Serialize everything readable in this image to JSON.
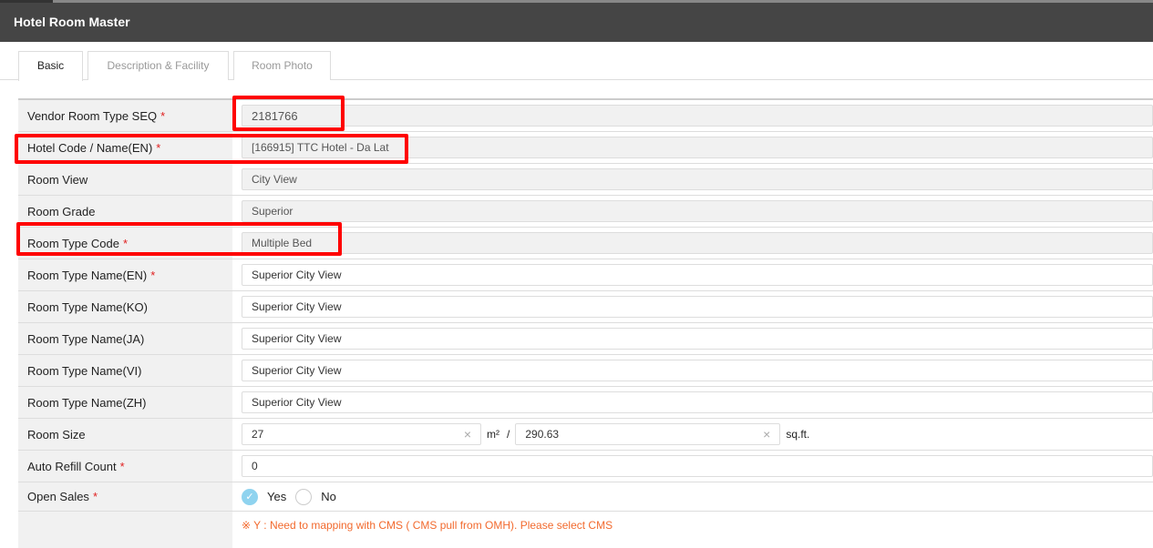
{
  "header": {
    "title": "Hotel Room Master"
  },
  "tabs": [
    {
      "label": "Basic"
    },
    {
      "label": "Description & Facility"
    },
    {
      "label": "Room Photo"
    }
  ],
  "form": {
    "vendor_seq": {
      "label": "Vendor Room Type SEQ",
      "value": "2181766"
    },
    "hotel": {
      "label": "Hotel Code / Name(EN)",
      "value": "[166915] TTC Hotel - Da Lat"
    },
    "room_view": {
      "label": "Room View",
      "value": "City View"
    },
    "room_grade": {
      "label": "Room Grade",
      "value": "Superior"
    },
    "room_type_code": {
      "label": "Room Type Code",
      "value": "Multiple Bed"
    },
    "name_en": {
      "label": "Room Type Name(EN)",
      "value": "Superior City View"
    },
    "name_ko": {
      "label": "Room Type Name(KO)",
      "value": "Superior City View"
    },
    "name_ja": {
      "label": "Room Type Name(JA)",
      "value": "Superior City View"
    },
    "name_vi": {
      "label": "Room Type Name(VI)",
      "value": "Superior City View"
    },
    "name_zh": {
      "label": "Room Type Name(ZH)",
      "value": "Superior City View"
    },
    "room_size": {
      "label": "Room Size",
      "sqm": "27",
      "sqm_unit": "m²",
      "sep": "/",
      "sqft": "290.63",
      "sqft_unit": "sq.ft."
    },
    "auto_refill": {
      "label": "Auto Refill Count",
      "value": "0"
    },
    "open_sales": {
      "label": "Open Sales",
      "yes": "Yes",
      "no": "No",
      "selected": "Yes"
    },
    "cms_note": "※ Y : Need to mapping with CMS ( CMS pull from OMH). Please select CMS",
    "required_mark": "*",
    "clear_icon": "×",
    "check_icon": "✓"
  },
  "colors": {
    "header": "#454545",
    "required": "#e02020",
    "note": "#f26a2e",
    "highlight": "#ff0000",
    "radio_on": "#8fd3ef"
  }
}
